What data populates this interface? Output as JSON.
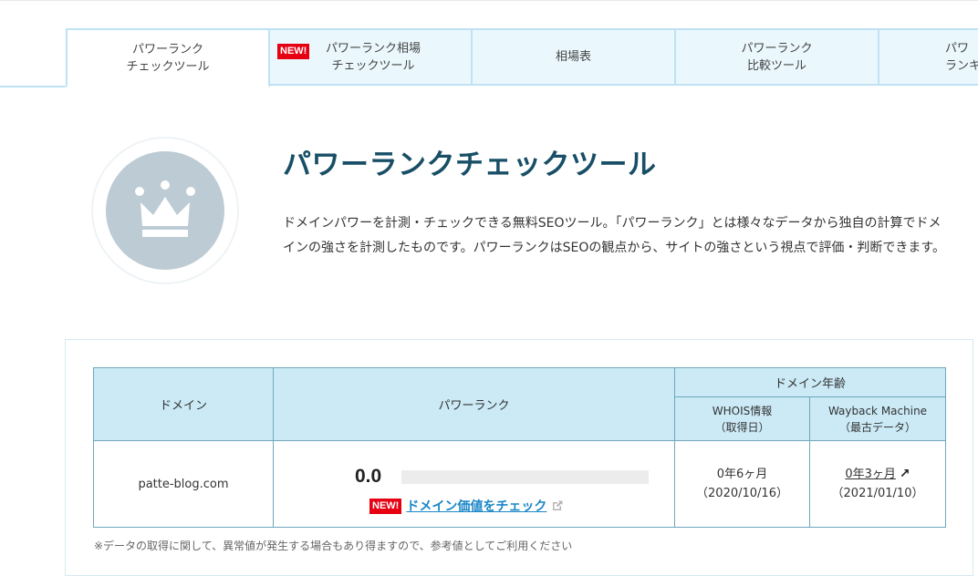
{
  "tabs": [
    {
      "label": "パワーランク\nチェックツール",
      "active": true,
      "badge": ""
    },
    {
      "label": "パワーランク相場\nチェックツール",
      "active": false,
      "badge": "NEW!"
    },
    {
      "label": "相場表",
      "active": false,
      "badge": ""
    },
    {
      "label": "パワーランク\n比較ツール",
      "active": false,
      "badge": ""
    },
    {
      "label": "パワ\nランキ",
      "active": false,
      "badge": ""
    }
  ],
  "hero": {
    "icon": "crown-icon",
    "title": "パワーランクチェックツール",
    "description": "ドメインパワーを計測・チェックできる無料SEOツール。「パワーランク」とは様々なデータから独自の計算でドメインの強さを計測したものです。パワーランクはSEOの観点から、サイトの強さという視点で評価・判断できます。"
  },
  "table": {
    "headers": {
      "domain": "ドメイン",
      "power_rank": "パワーランク",
      "domain_age": "ドメイン年齢",
      "whois": "WHOIS情報\n（取得日）",
      "wayback": "Wayback Machine\n（最古データ）"
    },
    "row": {
      "domain": "patte-blog.com",
      "power_rank": "0.0",
      "power_rank_fill": 0,
      "new_badge": "NEW!",
      "domain_value_link": "ドメイン価値をチェック",
      "whois_age": "0年6ヶ月",
      "whois_date": "（2020/10/16）",
      "wayback_age": "0年3ヶ月",
      "wayback_date": "（2021/01/10）"
    }
  },
  "note": "※データの取得に関して、異常値が発生する場合もあり得ますので、参考値としてご利用ください",
  "colors": {
    "accent": "#184f66",
    "tab_bg": "#eaf7fd",
    "header_bg": "#cbeaf6",
    "badge": "#e60012",
    "link": "#1a86c7",
    "crown_bg": "#bccbd4"
  }
}
